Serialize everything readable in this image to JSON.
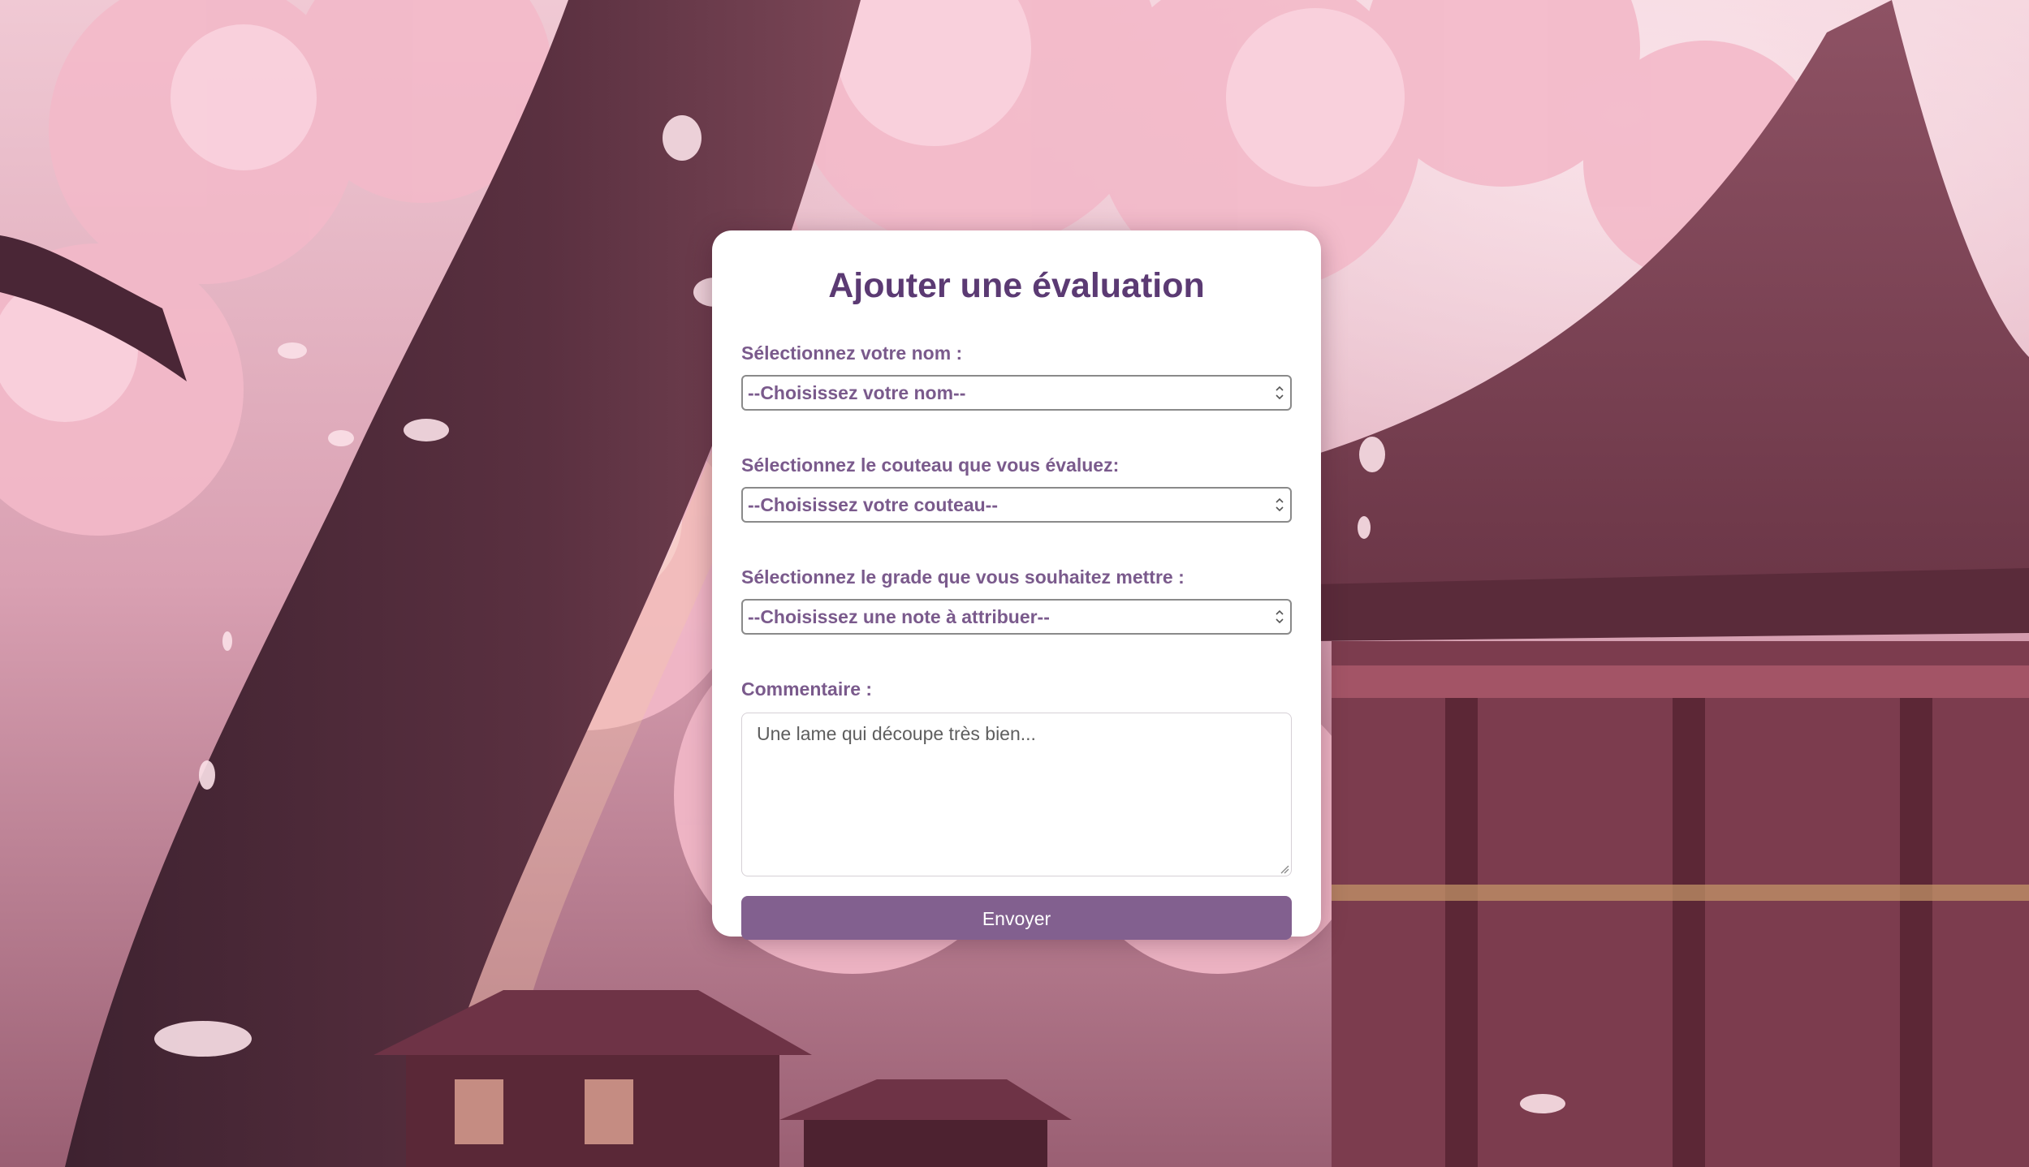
{
  "form": {
    "title": "Ajouter une évaluation",
    "fields": [
      {
        "label": "Sélectionnez votre nom :",
        "selected": "--Choisissez votre nom--"
      },
      {
        "label": "Sélectionnez le couteau que vous évaluez:",
        "selected": "--Choisissez votre couteau--"
      },
      {
        "label": "Sélectionnez le grade que vous souhaitez mettre :",
        "selected": "--Choisissez une note à attribuer--"
      }
    ],
    "comment": {
      "label": "Commentaire :",
      "placeholder": "Une lame qui découpe très bien..."
    },
    "submit_label": "Envoyer"
  },
  "background": {
    "description_icon": "cherry-blossom-temple-illustration"
  },
  "colors": {
    "title": "#5b3a73",
    "label": "#7a5a8c",
    "button": "#82608f",
    "card": "#ffffff"
  }
}
